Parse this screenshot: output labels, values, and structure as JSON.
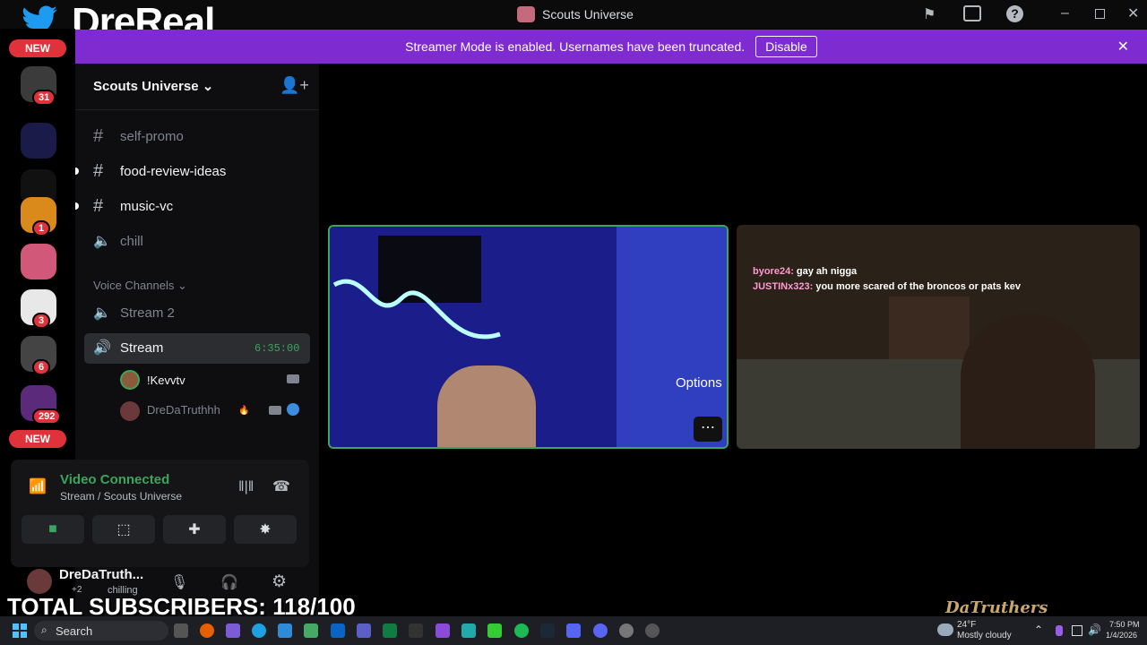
{
  "window": {
    "title": "Scouts Universe"
  },
  "overlay": {
    "channel_name": "DreReal_",
    "subscribers": "TOTAL SUBSCRIBERS: 118/100",
    "watermark": "DaTruthers"
  },
  "banner": {
    "text": "Streamer Mode is enabled. Usernames have been truncated.",
    "button": "Disable"
  },
  "rail": {
    "new_top": "NEW",
    "new_bottom": "NEW",
    "servers": [
      {
        "name": "server-1",
        "badge": "31",
        "color": "#3b3b3b"
      },
      {
        "name": "server-n",
        "badge": "",
        "color": "#1b1b4a"
      },
      {
        "name": "server-m",
        "badge": "",
        "color": "#111"
      },
      {
        "name": "server-goku",
        "badge": "1",
        "color": "#d98a1a"
      },
      {
        "name": "server-pink",
        "badge": "",
        "color": "#d2587a"
      },
      {
        "name": "server-beard",
        "badge": "3",
        "color": "#e8e8e8"
      },
      {
        "name": "server-squad",
        "badge": "6",
        "color": "#444"
      },
      {
        "name": "server-fck",
        "badge": "292",
        "color": "#5b2a7a"
      }
    ]
  },
  "sidebar": {
    "server_name": "Scouts Universe",
    "channels": [
      {
        "name": "self-promo",
        "type": "text",
        "unread": false
      },
      {
        "name": "food-review-ideas",
        "type": "text",
        "unread": true
      },
      {
        "name": "music-vc",
        "type": "text",
        "unread": true
      },
      {
        "name": "chill",
        "type": "voice",
        "unread": false
      }
    ],
    "voice_header": "Voice Channels",
    "voice_channels": [
      {
        "name": "Stream 2"
      },
      {
        "name": "Stream",
        "timer": "6:35:00",
        "active": true
      }
    ],
    "users": [
      {
        "name": "!Kevvtv"
      },
      {
        "name": "DreDaTruthhh"
      }
    ]
  },
  "voice_panel": {
    "status": "Video Connected",
    "location": "Stream / Scouts Universe"
  },
  "user_panel": {
    "name": "DreDaTruth...",
    "activity": "chilling",
    "extra": "+2"
  },
  "stream": {
    "tooltip": "Options",
    "chat": [
      {
        "user": "byore24:",
        "msg": "gay ah nigga"
      },
      {
        "user": "JUSTINx323:",
        "msg": "you more scared of the broncos or pats kev"
      }
    ]
  },
  "taskbar": {
    "search": "Search",
    "weather_temp": "24°F",
    "weather_desc": "Mostly cloudy",
    "time": "7:50 PM",
    "date": "1/4/2026"
  },
  "colors": {
    "accent": "#7e2bd2",
    "green": "#3ba55d",
    "badge": "#e0323b"
  }
}
